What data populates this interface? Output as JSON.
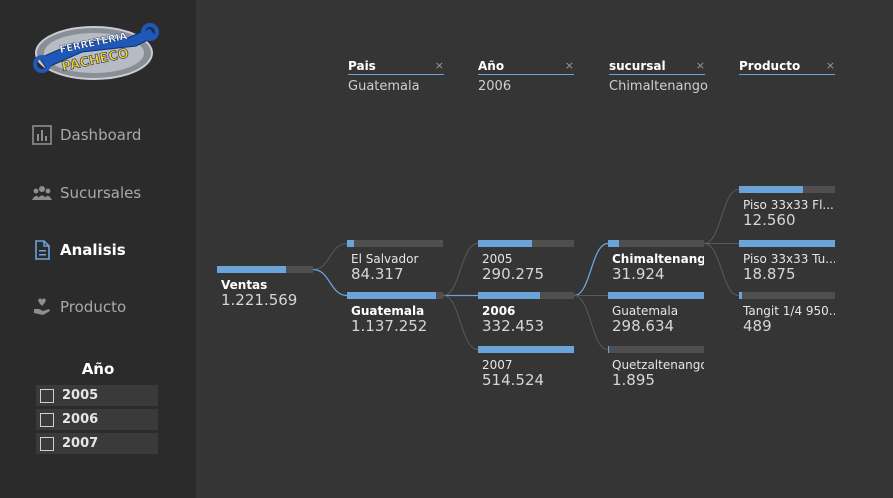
{
  "logo": {
    "line1": "FERRETERIA",
    "line2": "PACHECO"
  },
  "nav": [
    {
      "label": "Dashboard",
      "icon": "bar-chart-icon",
      "active": false
    },
    {
      "label": "Sucursales",
      "icon": "people-icon",
      "active": false
    },
    {
      "label": "Analisis",
      "icon": "document-icon",
      "active": true
    },
    {
      "label": "Producto",
      "icon": "hand-heart-icon",
      "active": false
    }
  ],
  "year_slicer": {
    "title": "Año",
    "options": [
      "2005",
      "2006",
      "2007"
    ]
  },
  "tree": {
    "levels": [
      {
        "name": "Pais",
        "value": "Guatemala"
      },
      {
        "name": "Año",
        "value": "2006"
      },
      {
        "name": "sucursal",
        "value": "Chimaltenango"
      },
      {
        "name": "Producto",
        "value": ""
      }
    ],
    "close_glyph": "×",
    "root": {
      "label": "Ventas",
      "value": "1.221.569",
      "fill": 0.72
    },
    "pais": [
      {
        "label": "El Salvador",
        "value": "84.317",
        "fill": 0.07
      },
      {
        "label": "Guatemala",
        "value": "1.137.252",
        "fill": 0.93
      }
    ],
    "anio": [
      {
        "label": "2005",
        "value": "290.275",
        "fill": 0.56
      },
      {
        "label": "2006",
        "value": "332.453",
        "fill": 0.65
      },
      {
        "label": "2007",
        "value": "514.524",
        "fill": 1.0
      }
    ],
    "sucursal": [
      {
        "label": "Chimaltenango",
        "value": "31.924",
        "fill": 0.11
      },
      {
        "label": "Guatemala",
        "value": "298.634",
        "fill": 1.0
      },
      {
        "label": "Quetzaltenango",
        "value": "1.895",
        "fill": 0.01
      }
    ],
    "producto": [
      {
        "label": "Piso 33x33 Fl...",
        "value": "12.560",
        "fill": 0.67
      },
      {
        "label": "Piso 33x33 Tu...",
        "value": "18.875",
        "fill": 1.0
      },
      {
        "label": "Tangit 1/4 950...",
        "value": "489",
        "fill": 0.03
      }
    ]
  },
  "colors": {
    "accent": "#6aa4d9",
    "background": "#353535",
    "sidebar": "#2b2b2b",
    "bar_track": "#4f4f4f"
  }
}
